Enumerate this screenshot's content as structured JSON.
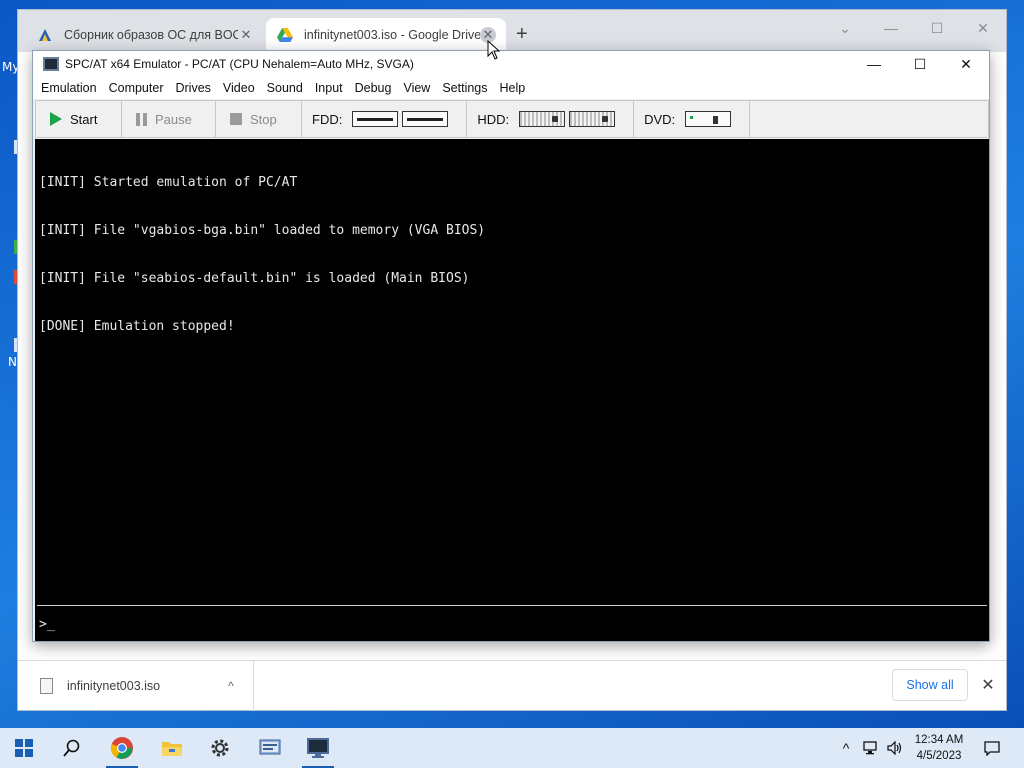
{
  "desktop": {
    "fragments": [
      "My",
      "N"
    ]
  },
  "browser": {
    "tabs": [
      {
        "title": "Сборник образов ОС для BOCHS",
        "close": "✕",
        "favicon": "bochs-icon"
      },
      {
        "title": "infinitynet003.iso - Google Drive",
        "close": "✕",
        "favicon": "google-drive-icon",
        "active": true
      }
    ],
    "new_tab": "+",
    "controls": {
      "tab_search": "⌄",
      "minimize": "—",
      "maximize": "☐",
      "close": "✕"
    }
  },
  "emulator": {
    "title": "SPC/AT x64 Emulator - PC/AT (CPU Nehalem=Auto MHz, SVGA)",
    "controls": {
      "minimize": "—",
      "maximize": "☐",
      "close": "✕"
    },
    "menu": [
      "Emulation",
      "Computer",
      "Drives",
      "Video",
      "Sound",
      "Input",
      "Debug",
      "View",
      "Settings",
      "Help"
    ],
    "toolbar": {
      "start": "Start",
      "pause": "Pause",
      "stop": "Stop",
      "fdd_label": "FDD:",
      "hdd_label": "HDD:",
      "dvd_label": "DVD:"
    },
    "console": {
      "lines": [
        "[INIT] Started emulation of PC/AT",
        "[INIT] File \"vgabios-bga.bin\" loaded to memory (VGA BIOS)",
        "[INIT] File \"seabios-default.bin\" is loaded (Main BIOS)",
        "[DONE] Emulation stopped!"
      ],
      "prompt": ">_"
    }
  },
  "download_shelf": {
    "file_name": "infinitynet003.iso",
    "chevron": "^",
    "show_all": "Show all",
    "close": "✕"
  },
  "taskbar": {
    "pinned": [
      "windows-start",
      "search",
      "chrome",
      "file-explorer",
      "settings",
      "control-panel",
      "spc-at-emulator"
    ],
    "tray": {
      "chevron": "^"
    },
    "clock": {
      "time": "12:34 AM",
      "date": "4/5/2023"
    }
  },
  "colors": {
    "desktop": "#1a63c9",
    "taskbar": "#dde9f7",
    "console_bg": "#000000",
    "start_green": "#1aa34a",
    "link_blue": "#1a73e8"
  }
}
